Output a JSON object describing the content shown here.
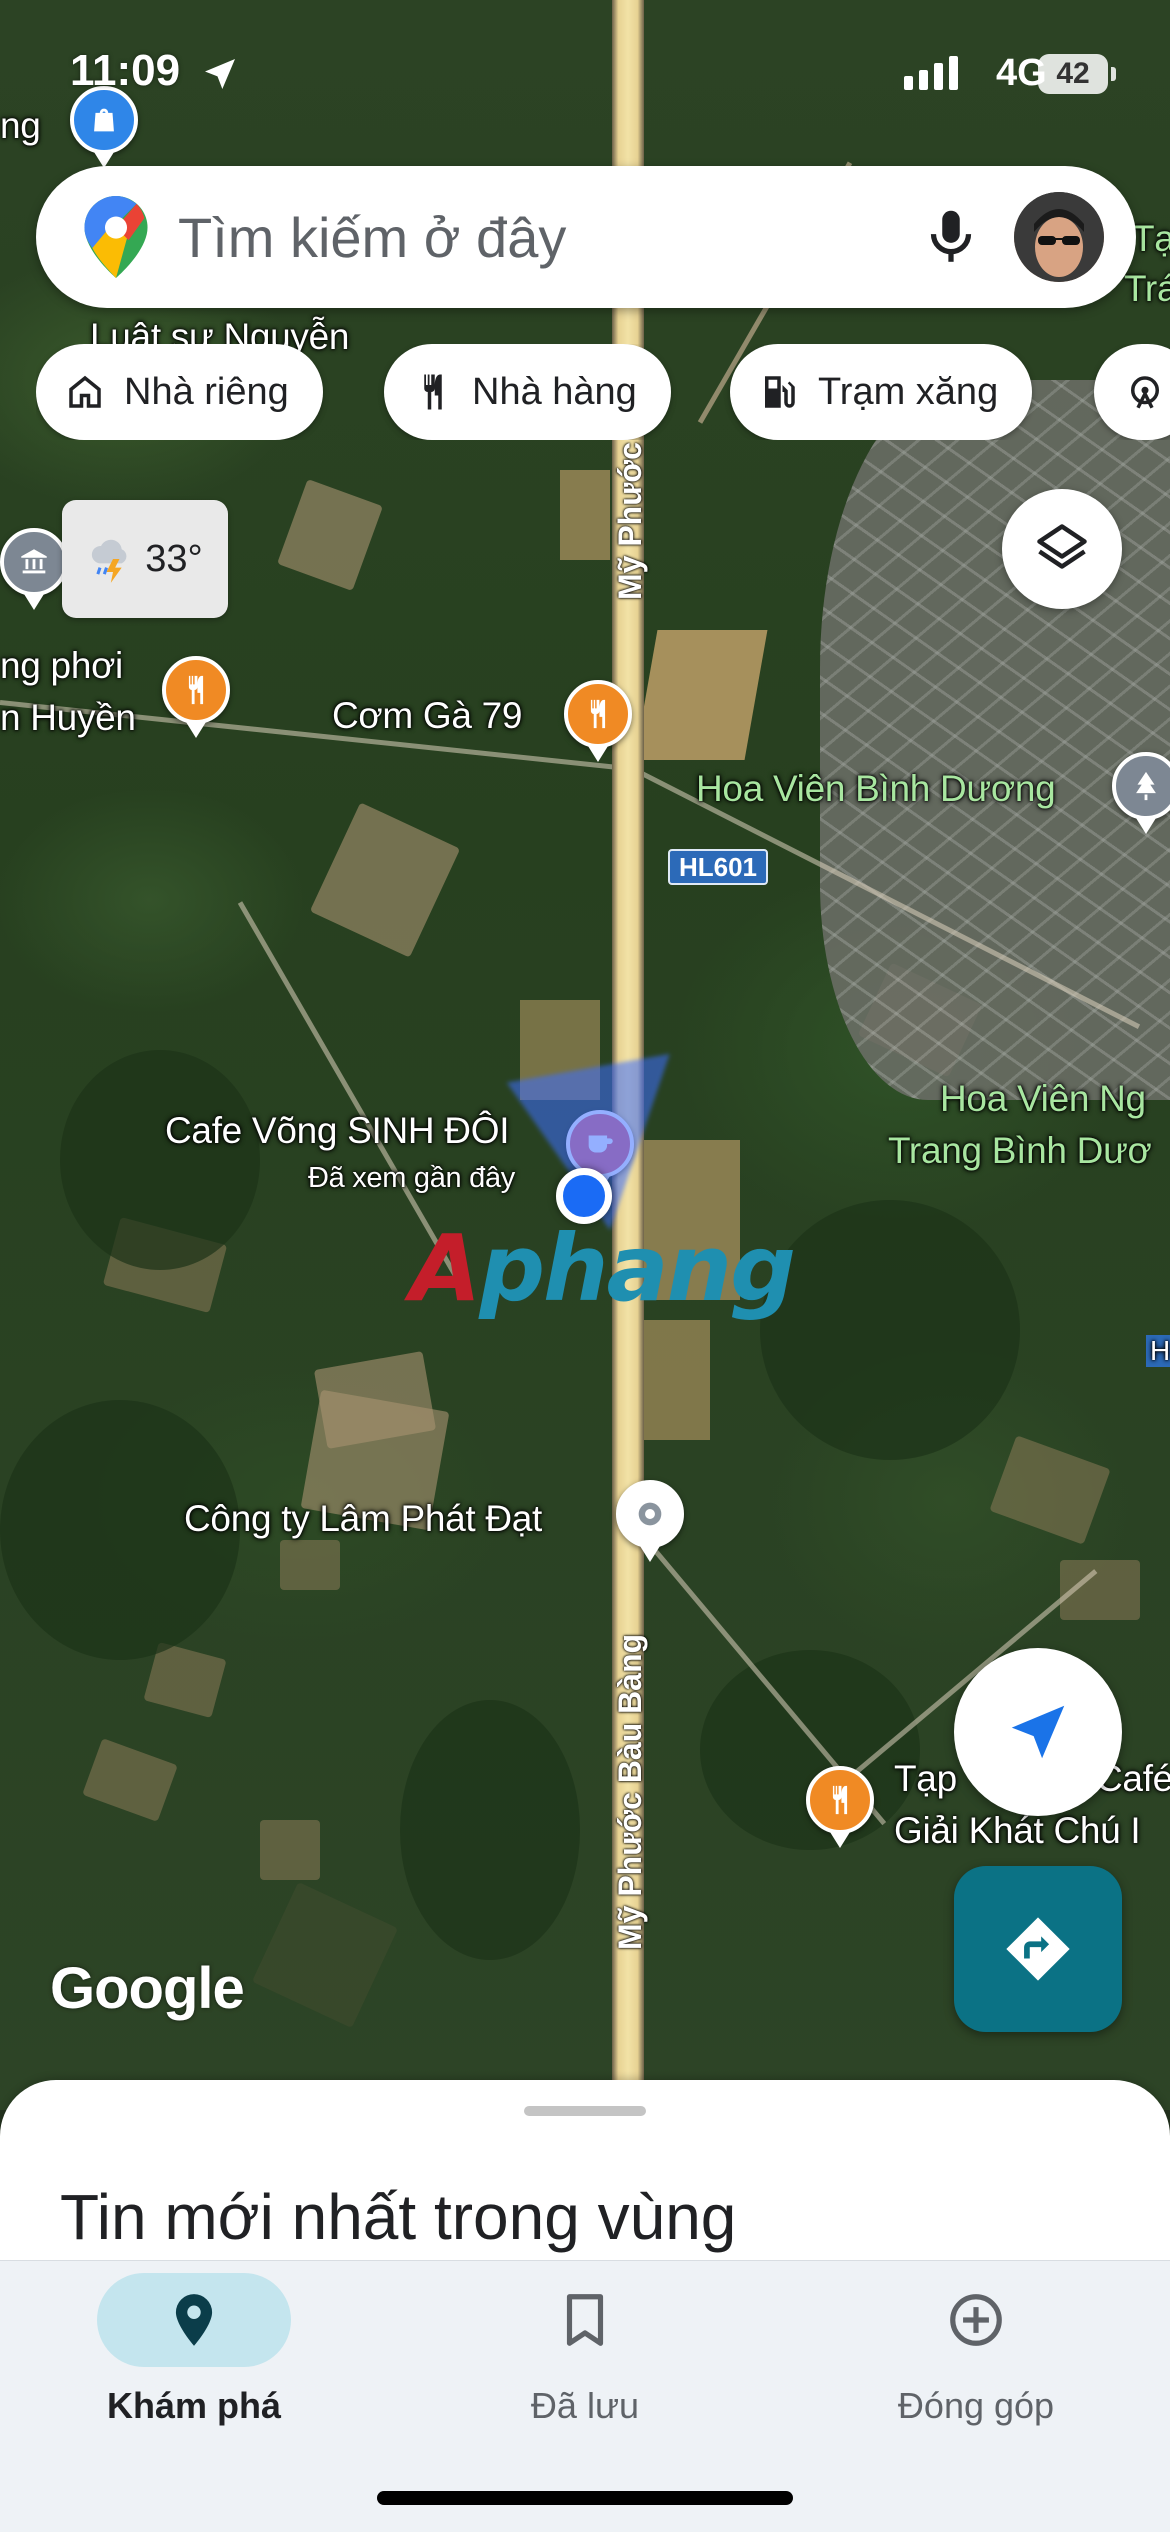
{
  "status_bar": {
    "time": "11:09",
    "network": "4G",
    "battery": "42"
  },
  "search": {
    "placeholder": "Tìm kiếm ở đây"
  },
  "chips": [
    {
      "label": "Nhà riêng",
      "icon": "home-icon"
    },
    {
      "label": "Nhà hàng",
      "icon": "restaurant-icon"
    },
    {
      "label": "Trạm xăng",
      "icon": "gas-station-icon"
    },
    {
      "label": "",
      "icon": "attraction-icon"
    }
  ],
  "weather": {
    "temperature": "33°",
    "icon": "thunderstorm-icon"
  },
  "map": {
    "labels": {
      "partial_top_left": "ng",
      "partial_top_name": "Luật sư Nguyễn",
      "partial_left_1": "ng phơi",
      "partial_left_2": "n Huyền",
      "com_ga": "Cơm Gà 79",
      "hoa_vien": "Hoa Viên Bình Dương",
      "hoa_vien_ng_1": "Hoa Viên Ng",
      "hoa_vien_ng_2": "Trang Bình Dươ",
      "cafe_vong": "Cafe Võng SINH ĐÔI",
      "recently_viewed": "Đã xem gần đây",
      "cong_ty": "Công ty Lâm Phát Đạt",
      "tap_hoa_1": "Tạp",
      "tap_hoa_1b": "Café",
      "tap_hoa_2": "Giải Khát Chú I",
      "partial_right_top_1": "Tạ",
      "partial_right_top_2": "Trá",
      "partial_right_h": "H"
    },
    "road_name_top": "Mỹ Phước Bà",
    "road_name_bottom": "Mỹ Phước Bàu Bàng",
    "road_badge": "HL601",
    "watermark_part1": "A",
    "watermark_part2": "phang",
    "provider_logo": "Google",
    "colors": {
      "poi_orange": "#f08a24",
      "location_blue": "#1a6bf5",
      "directions_teal": "#0b7285"
    }
  },
  "sheet": {
    "title": "Tin mới nhất trong vùng"
  },
  "bottom_nav": [
    {
      "label": "Khám phá",
      "icon": "explore-pin-icon",
      "active": true
    },
    {
      "label": "Đã lưu",
      "icon": "bookmark-icon",
      "active": false
    },
    {
      "label": "Đóng góp",
      "icon": "add-circle-icon",
      "active": false
    }
  ]
}
